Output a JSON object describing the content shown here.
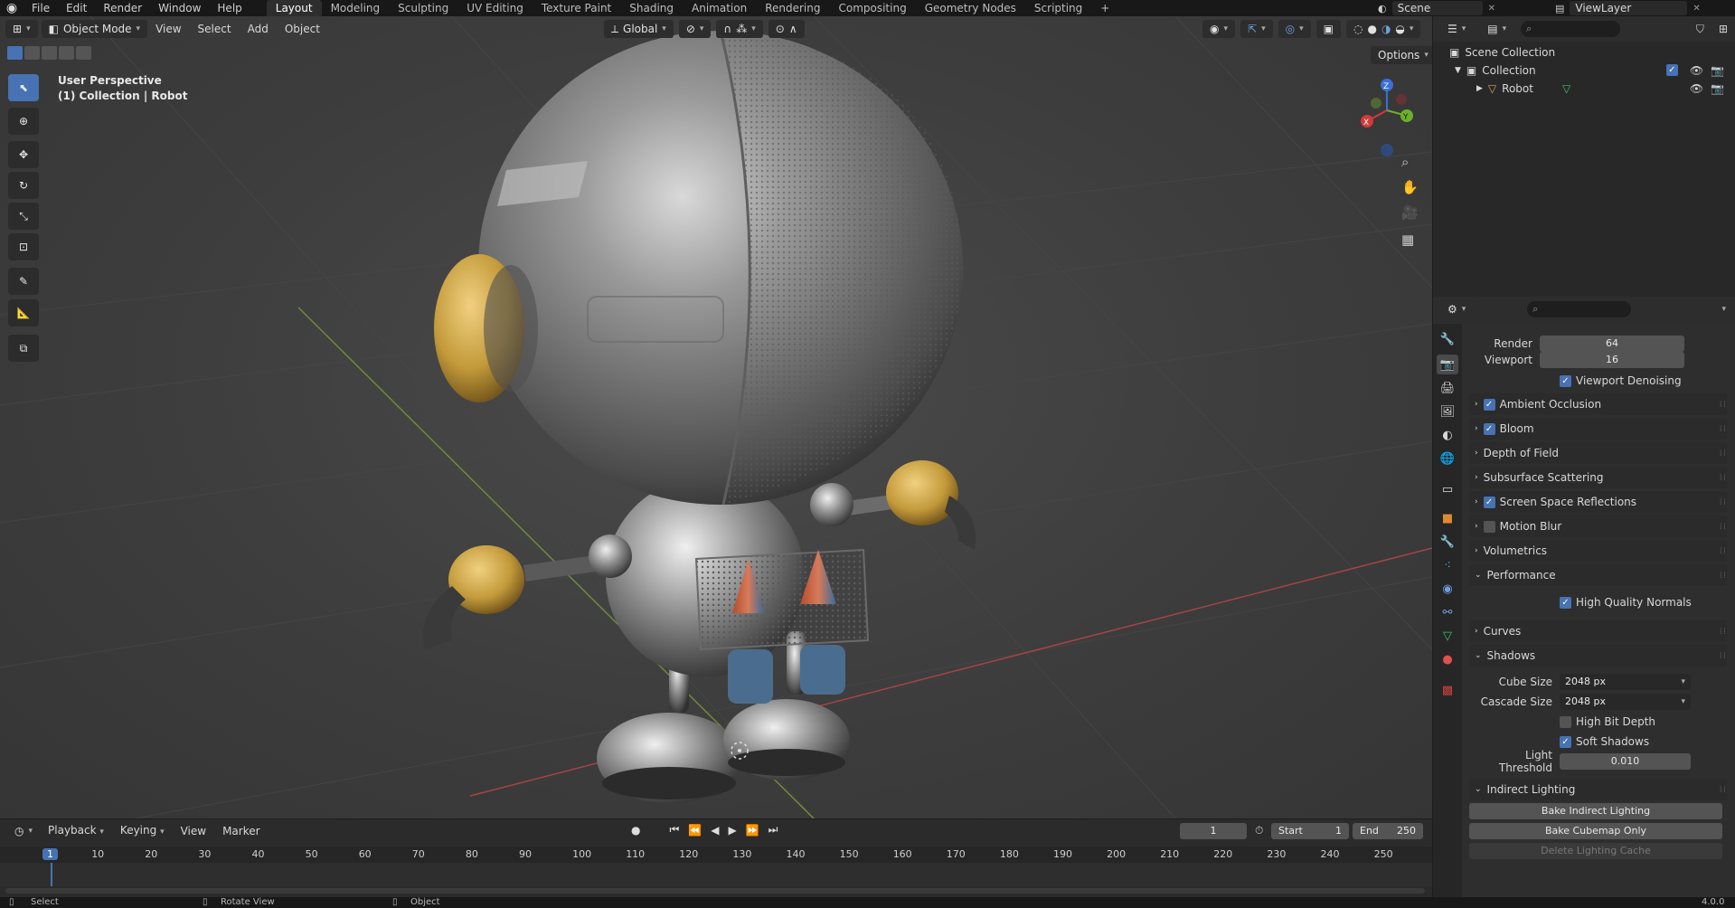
{
  "menu": {
    "logo": "◉",
    "items": [
      "File",
      "Edit",
      "Render",
      "Window",
      "Help"
    ],
    "workspaces": [
      "Layout",
      "Modeling",
      "Sculpting",
      "UV Editing",
      "Texture Paint",
      "Shading",
      "Animation",
      "Rendering",
      "Compositing",
      "Geometry Nodes",
      "Scripting"
    ],
    "add_ws": "+",
    "scene": "Scene",
    "view_layer": "ViewLayer"
  },
  "viewport": {
    "mode": "Object Mode",
    "menus": [
      "View",
      "Select",
      "Add",
      "Object"
    ],
    "orientation": "Global",
    "options": "Options",
    "perspective": "User Perspective",
    "collection_info": "(1) Collection | Robot",
    "gizmo": {
      "x": "X",
      "y": "Y",
      "z": "Z"
    }
  },
  "outliner": {
    "scene_collection": "Scene Collection",
    "collection": "Collection",
    "object": "Robot"
  },
  "properties": {
    "render_label": "Render",
    "render_value": "64",
    "viewport_label": "Viewport",
    "viewport_value": "16",
    "viewport_denoising": "Viewport Denoising",
    "panels": [
      "Ambient Occlusion",
      "Bloom",
      "Depth of Field",
      "Subsurface Scattering",
      "Screen Space Reflections",
      "Motion Blur",
      "Volumetrics",
      "Performance"
    ],
    "high_quality_normals": "High Quality Normals",
    "curves": "Curves",
    "shadows": "Shadows",
    "cube_size_label": "Cube Size",
    "cube_size_value": "2048 px",
    "cascade_size_label": "Cascade Size",
    "cascade_size_value": "2048 px",
    "high_bit_depth": "High Bit Depth",
    "soft_shadows": "Soft Shadows",
    "light_threshold_label": "Light Threshold",
    "light_threshold_value": "0.010",
    "indirect_lighting": "Indirect Lighting",
    "bake_indirect": "Bake Indirect Lighting",
    "bake_cubemap": "Bake Cubemap Only",
    "delete_cache": "Delete Lighting Cache"
  },
  "timeline": {
    "menus": [
      "Playback",
      "Keying",
      "View",
      "Marker"
    ],
    "current_frame": "1",
    "start_label": "Start",
    "start_value": "1",
    "end_label": "End",
    "end_value": "250",
    "ruler": [
      "1",
      "10",
      "20",
      "30",
      "40",
      "50",
      "60",
      "70",
      "80",
      "90",
      "100",
      "110",
      "120",
      "130",
      "140",
      "150",
      "160",
      "170",
      "180",
      "190",
      "200",
      "210",
      "220",
      "230",
      "240",
      "250"
    ]
  },
  "status": {
    "select": "Select",
    "rotate": "Rotate View",
    "object": "Object",
    "version": "4.0.0"
  }
}
